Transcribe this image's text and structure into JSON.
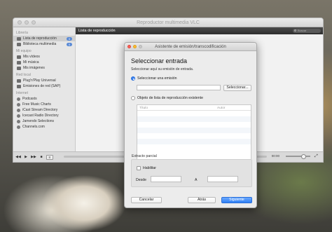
{
  "window": {
    "title": "Reproductor multimedia VLC"
  },
  "sidebar": {
    "sections": [
      {
        "title": "Librería",
        "items": [
          {
            "label": "Lista de reproducción",
            "count": "0",
            "icon": "playlist-icon"
          },
          {
            "label": "Biblioteca multimedia",
            "count": "0",
            "icon": "library-icon"
          }
        ]
      },
      {
        "title": "Mi equipo",
        "items": [
          {
            "label": "Mis vídeos",
            "icon": "film-icon"
          },
          {
            "label": "Mi música",
            "icon": "music-note-icon"
          },
          {
            "label": "Mis imágenes",
            "icon": "image-icon"
          }
        ]
      },
      {
        "title": "Red local",
        "items": [
          {
            "label": "Plug'n'Play Universal",
            "icon": "network-icon"
          },
          {
            "label": "Emisiones de red (SAP)",
            "icon": "network-icon"
          }
        ]
      },
      {
        "title": "Internet",
        "items": [
          {
            "label": "Podcasts",
            "icon": "globe-icon"
          },
          {
            "label": "Free Music Charts",
            "icon": "globe-icon"
          },
          {
            "label": "iCast Stream Directory",
            "icon": "globe-icon"
          },
          {
            "label": "Icecast Radio Directory",
            "icon": "globe-icon"
          },
          {
            "label": "Jamendo Selections",
            "icon": "globe-icon"
          },
          {
            "label": "Channels.com",
            "icon": "globe-icon"
          }
        ]
      }
    ]
  },
  "playlist": {
    "header": "Lista de reproducción",
    "search_placeholder": "Buscar"
  },
  "controls": {
    "time": "00:00"
  },
  "dialog": {
    "title": "Asistente de emisión/transcodificación",
    "heading": "Seleccionar entrada",
    "subheading": "Seleccionar aquí su emisión de entrada.",
    "option_stream": "Seleccionar una emisión",
    "select_button": "Seleccionar...",
    "option_playlist": "Objeto de lista de reproducción existente",
    "list_columns": [
      "Título",
      "Autor"
    ],
    "partial_extract": "Extracto parcial",
    "enable": "Habilitar",
    "from": "Desde",
    "to": "A",
    "cancel": "Cancelar",
    "back": "Atrás",
    "next": "Siguiente"
  },
  "colors": {
    "accent": "#2f7ff4",
    "playlist_header": "#3a3a3a"
  }
}
